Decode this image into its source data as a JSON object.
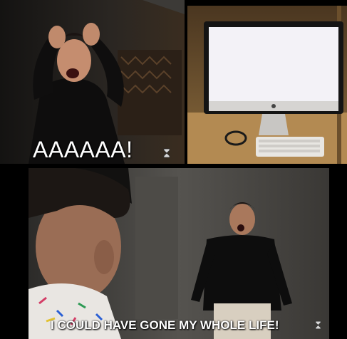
{
  "panels": {
    "top_left": {
      "caption": "AAAAAA!"
    },
    "top_right": {},
    "bottom": {
      "caption": "I COULD HAVE GONE MY WHOLE LIFE!"
    }
  },
  "icons": [
    "hourglass-icon"
  ],
  "colors": {
    "background": "#000000",
    "caption_text": "#ffffff",
    "screen_glow": "#f3f2f7"
  }
}
